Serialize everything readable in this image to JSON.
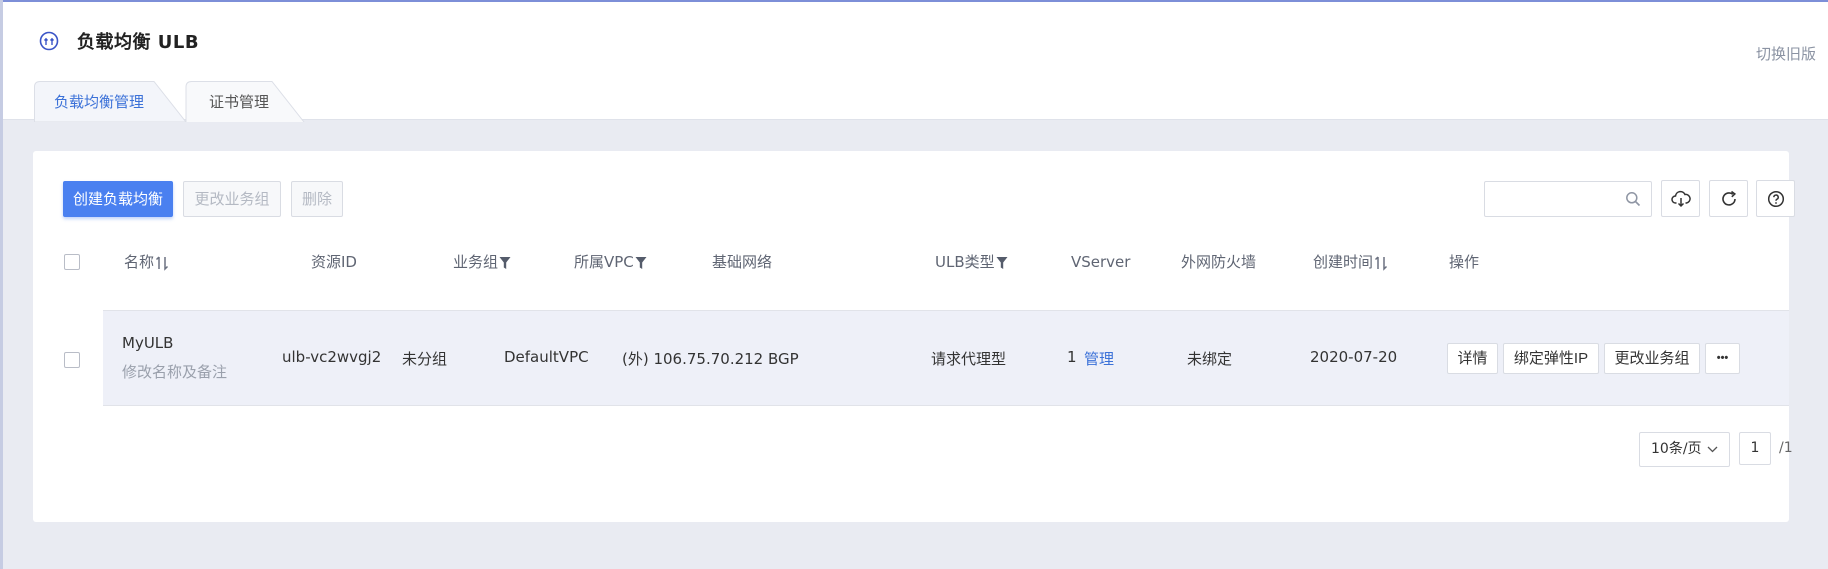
{
  "header": {
    "title": "负载均衡 ULB",
    "icon": "ulb-logo-icon",
    "switch_label": "切换旧版",
    "tabs": [
      {
        "label": "负载均衡管理",
        "active": true
      },
      {
        "label": "证书管理",
        "active": false
      }
    ]
  },
  "toolbar": {
    "create_label": "创建负载均衡",
    "change_group_label": "更改业务组",
    "delete_label": "删除",
    "search_placeholder": "",
    "icons": [
      "cloud-download-icon",
      "refresh-icon",
      "help-icon"
    ]
  },
  "table": {
    "columns": [
      "名称",
      "资源ID",
      "业务组",
      "所属VPC",
      "基础网络",
      "ULB类型",
      "VServer",
      "外网防火墙",
      "创建时间",
      "操作"
    ],
    "rows": [
      {
        "name": "MyULB",
        "remark": "修改名称及备注",
        "resource_id": "ulb-vc2wvgj2",
        "group": "未分组",
        "vpc": "DefaultVPC",
        "network": "(外) 106.75.70.212 BGP",
        "ulb_type": "请求代理型",
        "vserver_count": "1",
        "vserver_manage": "管理",
        "firewall": "未绑定",
        "created": "2020-07-20",
        "actions": [
          "详情",
          "绑定弹性IP",
          "更改业务组",
          "•••"
        ]
      }
    ]
  },
  "pagination": {
    "page_size": "10条/页",
    "current_page": "1",
    "total_pages": "/1"
  },
  "colors": {
    "accent": "#4a80f0",
    "link": "#3b71d8",
    "row_bg": "#eef0f8",
    "page_bg": "#e9ebf2"
  }
}
